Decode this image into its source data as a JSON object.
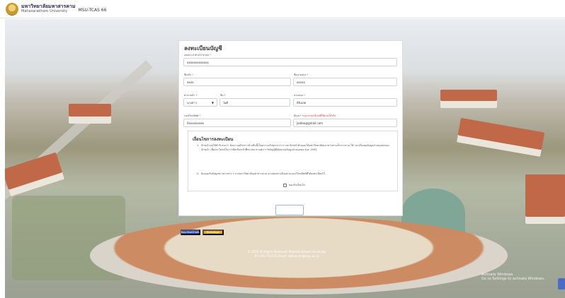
{
  "header": {
    "brand_th": "มหาวิทยาลัยมหาสารคาม",
    "brand_en": "Mahasarakham University",
    "system": "MSU-TCAS 66"
  },
  "form": {
    "title": "ลงทะเบียนบัญชี",
    "fields": {
      "citizen_id": {
        "label": "เลขประจำตัวประชาชน",
        "value": "xxxxxxxxxxxxx"
      },
      "first_name": {
        "label": "ชื่อจริง",
        "value": "xxxx"
      },
      "last_name": {
        "label": "ชื่อนามสกุล",
        "value": "xxxxx"
      },
      "title_prefix": {
        "label": "คำนำหน้า",
        "value": "นางสาว"
      },
      "nickname": {
        "label": "ชื่อ",
        "value": "ไอดี"
      },
      "school": {
        "label": "ตามสกุล",
        "value": "ดีจังเลย"
      },
      "phone": {
        "label": "เบอร์โทรศัพท์",
        "value": "0xxxxxxxxx"
      },
      "email": {
        "label": "อีเมล",
        "note": "กรุณากรอกอีเมลที่ใช้งานได้จริง",
        "value": "jaidee@gmail.com"
      }
    },
    "required_mark": "*",
    "terms": {
      "title": "เงื่อนไขการลงทะเบียน",
      "items": [
        {
          "num": "1.",
          "text": "ข้าพเจ้าขอให้คำรับรองว่า ข้อความดังกล่าวข้างต้นนี้เป็นความจริงทุกประการ และข้าพเจ้ายินยอมให้มหาวิทยาลัยมหาสารคามเก็บรวบรวม ใช้ และเปิดเผยข้อมูลส่วนบุคคลของข้าพเจ้า เพื่อประโยชน์ในการคัดเลือกเข้าศึกษาต่อ ตามพระราชบัญญัติคุ้มครองข้อมูลส่วนบุคคล พ.ศ. 2562"
        },
        {
          "num": "2.",
          "text": "ยินยอมรับข้อมูลข่าวสารต่าง ๆ จากมหาวิทยาลัยมหาสารคาม ผ่านช่องทางอีเมลและเบอร์โทรศัพท์ที่ได้ลงทะเบียนไว้"
        }
      ],
      "agree_label": "ยอมรับเงื่อนไข"
    }
  },
  "buttons": {
    "back": "ย้อนกลับหน้าหลัก",
    "save": "ยืนยันข้อมูล"
  },
  "footer": {
    "line1": "© 2022 All Rights Reserved. Mahasarakham University",
    "line2": "Tel. 043-754333 Email: admission@msu.ac.th"
  },
  "watermark": {
    "line1": "Activate Windows",
    "line2": "Go to Settings to activate Windows."
  }
}
